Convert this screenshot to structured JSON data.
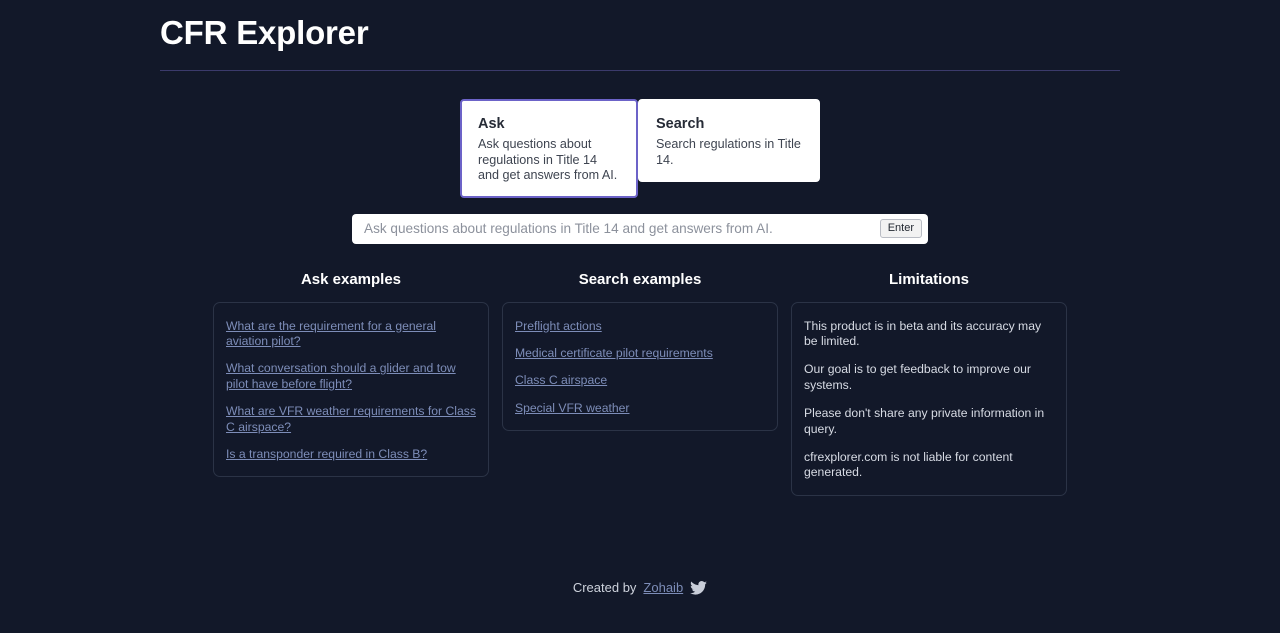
{
  "header": {
    "title": "CFR Explorer"
  },
  "tabs": [
    {
      "id": "ask",
      "title": "Ask",
      "description": "Ask questions about regulations in Title 14 and get answers from AI.",
      "selected": true
    },
    {
      "id": "search",
      "title": "Search",
      "description": "Search regulations in Title 14.",
      "selected": false
    }
  ],
  "query": {
    "value": "",
    "placeholder": "Ask questions about regulations in Title 14 and get answers from AI.",
    "submit_label": "Enter"
  },
  "columns": [
    {
      "id": "ask-examples",
      "heading": "Ask examples",
      "items": [
        "What are the requirement for a general aviation pilot?",
        "What conversation should a glider and tow pilot have before flight?",
        "What are VFR weather requirements for Class C airspace?",
        "Is a transponder required in Class B?"
      ]
    },
    {
      "id": "search-examples",
      "heading": "Search examples",
      "items": [
        "Preflight actions",
        "Medical certificate pilot requirements",
        "Class C airspace",
        "Special VFR weather"
      ]
    },
    {
      "id": "limitations",
      "heading": "Limitations",
      "items": [
        "This product is in beta and its accuracy may be limited.",
        "Our goal is to get feedback to improve our systems.",
        "Please don't share any private information in query.",
        "cfrexplorer.com is not liable for content generated."
      ]
    }
  ],
  "footer": {
    "prefix": "Created by",
    "author": "Zohaib",
    "icon": "twitter-icon"
  },
  "colors": {
    "background": "#121829",
    "accent": "#6c63c8",
    "link": "#7d8db8",
    "card_border": "#2b3346",
    "divider": "#3b3a6b"
  }
}
